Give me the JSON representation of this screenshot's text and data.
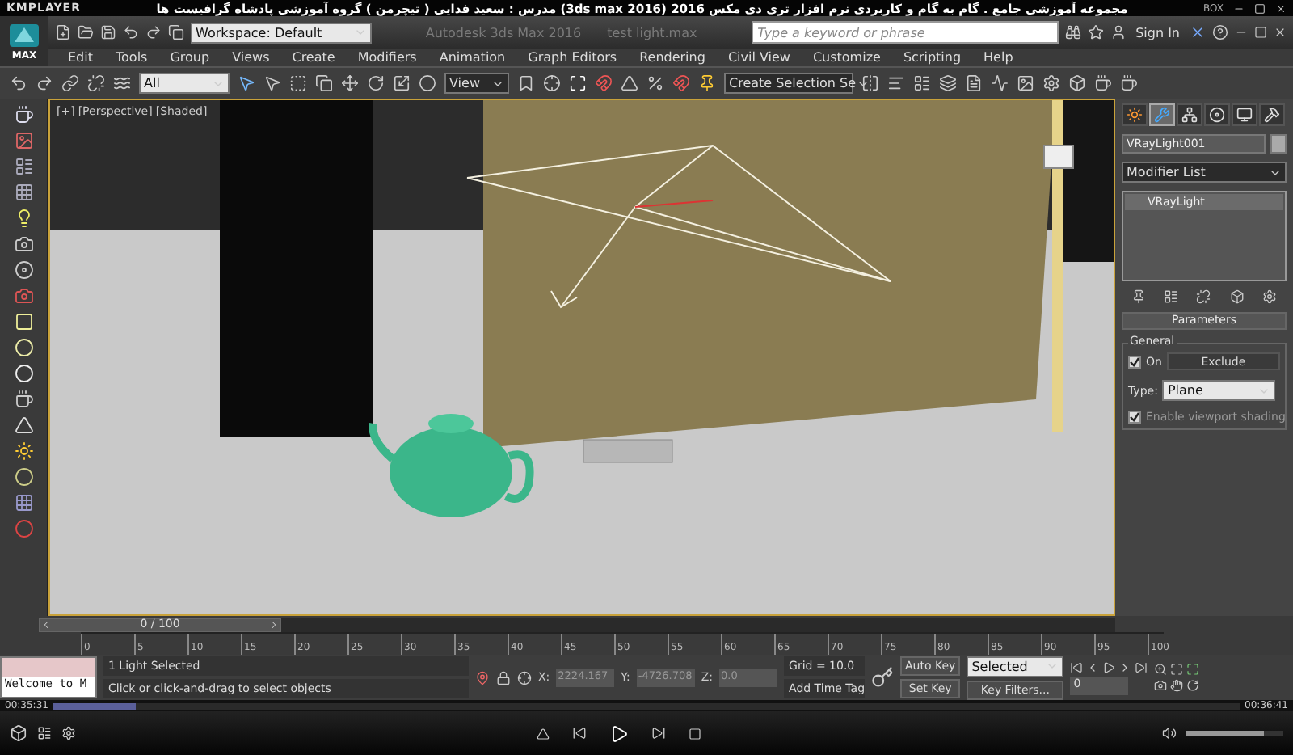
{
  "player": {
    "name": "KMPLAYER",
    "title": "مجموعه آموزشی جامع . گام به گام و کاربردی نرم افزار تری دی مکس 2016 (3ds max 2016)   مدرس : سعید فدایی ( تیچرمن ) گروه آموزشی پادشاه گرافیست ها",
    "badge": "BOX",
    "elapsed": "00:35:31",
    "total": "00:36:41",
    "level": 0.07,
    "volume": {
      "level": 0.8
    }
  },
  "app": {
    "logo": "MAX",
    "workspace": "Workspace: Default",
    "title": "Autodesk 3ds Max 2016",
    "file": "test light.max",
    "search_placeholder": "Type a keyword or phrase",
    "sign_in": "Sign In"
  },
  "menu": [
    "Edit",
    "Tools",
    "Group",
    "Views",
    "Create",
    "Modifiers",
    "Animation",
    "Graph Editors",
    "Rendering",
    "Civil View",
    "Customize",
    "Scripting",
    "Help"
  ],
  "toolbar": {
    "filter": "All",
    "coord": "View",
    "selection_set": "Create Selection Se"
  },
  "viewport": {
    "labels": [
      "[+]",
      "[Perspective]",
      "[Shaded]"
    ]
  },
  "command_panel": {
    "tabs": [
      {
        "selected": false
      },
      {
        "selected": true
      },
      {
        "selected": false
      },
      {
        "selected": false
      },
      {
        "selected": false
      },
      {
        "selected": false
      }
    ],
    "object_name": "VRayLight001",
    "modifier_list": "Modifier List",
    "stack": [
      {
        "label": "VRayLight",
        "selected": true
      }
    ],
    "rollout": "Parameters",
    "group": "General",
    "on": {
      "label": "On",
      "checked": true
    },
    "exclude": "Exclude",
    "type_label": "Type:",
    "type_value": "Plane",
    "viewport_shading": {
      "label": "Enable viewport shading",
      "checked": true
    }
  },
  "timeline": {
    "position": "0 / 100",
    "ticks": [
      "0",
      "5",
      "10",
      "15",
      "20",
      "25",
      "30",
      "35",
      "40",
      "45",
      "50",
      "55",
      "60",
      "65",
      "70",
      "75",
      "80",
      "85",
      "90",
      "95",
      "100"
    ]
  },
  "status": {
    "listener": "Welcome to M",
    "selection": "1 Light Selected",
    "prompt": "Click or click-and-drag to select objects",
    "coords": [
      {
        "label": "X:",
        "value": "2224.167"
      },
      {
        "label": "Y:",
        "value": "-4726.708"
      },
      {
        "label": "Z:",
        "value": "0.0"
      }
    ],
    "grid": "Grid = 10.0",
    "time_tag": "Add Time Tag",
    "auto_key": "Auto Key",
    "key_mode": "Selected",
    "set_key": "Set Key",
    "key_filters": "Key Filters...",
    "frame": "0"
  }
}
